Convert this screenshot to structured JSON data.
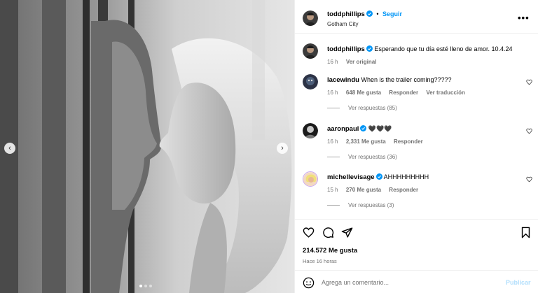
{
  "post": {
    "carousel_dots": 3,
    "active_dot": 0
  },
  "header": {
    "username": "toddphillips",
    "separator": "•",
    "follow_label": "Seguir",
    "location": "Gotham City",
    "more_icon": "more-horizontal-icon"
  },
  "caption": {
    "username": "toddphillips",
    "text": "Esperando que tu día esté lleno de amor. 10.4.24",
    "time": "16 h",
    "see_original": "Ver original"
  },
  "comments": [
    {
      "username": "lacewindu",
      "verified": false,
      "text": "When is the trailer coming?????",
      "time": "16 h",
      "likes": "648 Me gusta",
      "reply": "Responder",
      "translate": "Ver traducción",
      "replies": "Ver respuestas (85)"
    },
    {
      "username": "aaronpaul",
      "verified": true,
      "text": "🖤🖤🖤",
      "time": "16 h",
      "likes": "2,331 Me gusta",
      "reply": "Responder",
      "replies": "Ver respuestas (36)"
    },
    {
      "username": "michellevisage",
      "verified": true,
      "text": "AHHHHHHHHH",
      "time": "15 h",
      "likes": "270 Me gusta",
      "reply": "Responder",
      "replies": "Ver respuestas (3)"
    }
  ],
  "actions": {
    "likes": "214.572 Me gusta",
    "time_ago": "Hace 16 horas"
  },
  "add_comment": {
    "placeholder": "Agrega un comentario...",
    "publish_label": "Publicar"
  },
  "colors": {
    "accent": "#0095f6",
    "verified": "#0095f6",
    "publish_disabled": "#b2dffc"
  }
}
